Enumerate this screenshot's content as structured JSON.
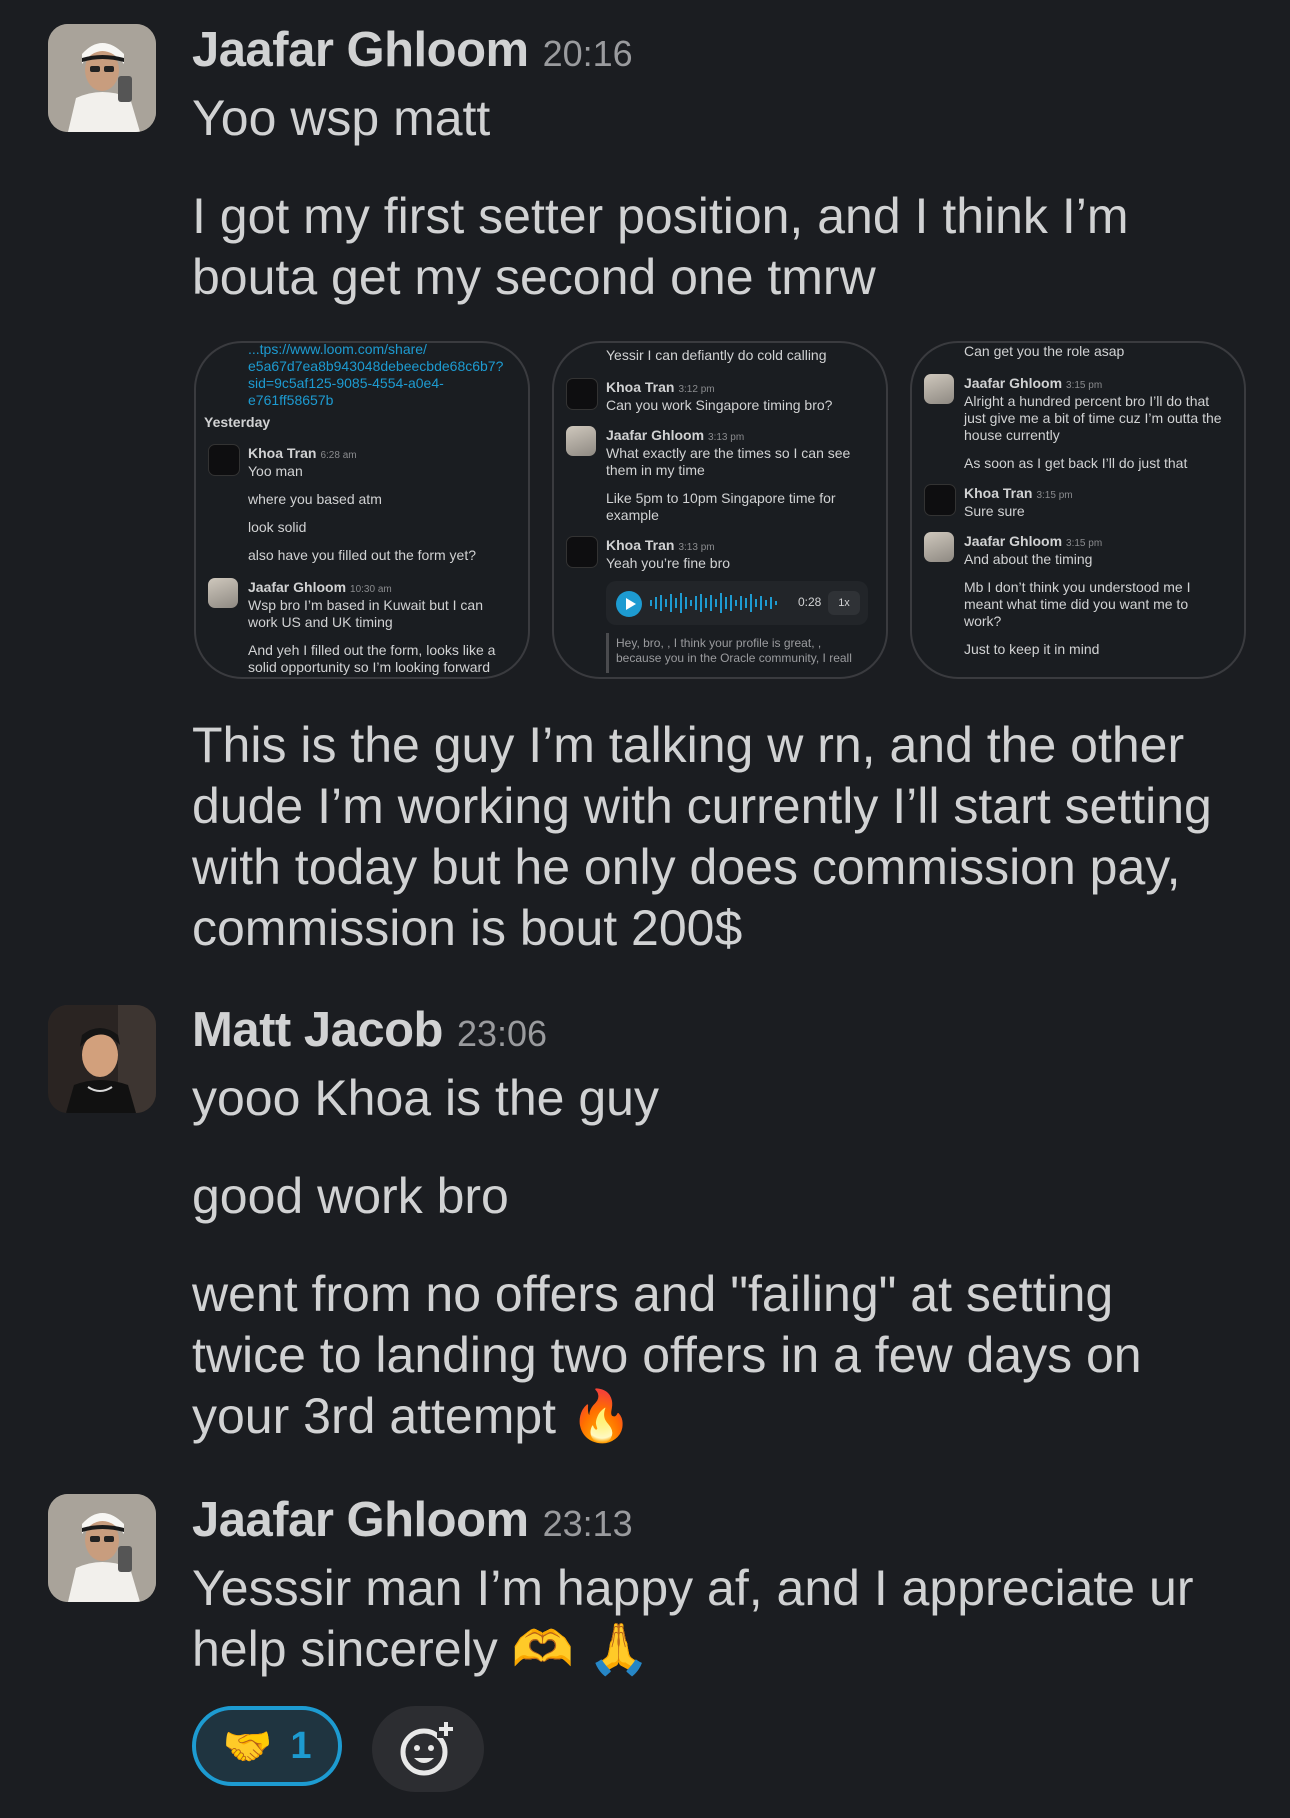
{
  "messages": [
    {
      "author": "Jaafar Ghloom",
      "time": "20:16",
      "avatar_icon": "avatar-photo",
      "paragraphs": [
        "Yoo wsp matt",
        "I got my first setter position, and I think I’m bouta get my second one tmrw",
        "This is the guy I’m talking w rn, and the other dude I’m working with currently I’ll start setting with today but he only does commission pay, commission is bout 200$"
      ]
    },
    {
      "author": "Matt Jacob",
      "time": "23:06",
      "avatar_icon": "avatar-photo",
      "paragraphs": [
        "yooo Khoa is the guy",
        "good work bro",
        "went from no offers and \"failing\" at setting twice to landing two offers in a few days on your 3rd attempt 🔥"
      ]
    },
    {
      "author": "Jaafar Ghloom",
      "time": "23:13",
      "avatar_icon": "avatar-photo",
      "paragraphs": [
        "Yesssir man I’m happy af, and I appreciate ur help sincerely 🫶 🙏"
      ]
    }
  ],
  "attachments": [
    {
      "link": [
        "...tps://www.loom.com/share/",
        "e5a67d7ea8b943048debeecbde68c6b7?",
        "sid=9c5af125-9085-4554-a0e4-",
        "e761ff58657b"
      ],
      "day_label": "Yesterday",
      "khoa_name": "Khoa Tran",
      "khoa_time": "6:28 am",
      "khoa_lines": [
        "Yoo man",
        "where you based atm",
        "look solid",
        "also have you filled out the form yet?"
      ],
      "jaafar_name": "Jaafar Ghloom",
      "jaafar_time": "10:30 am",
      "jaafar_lines": [
        "Wsp bro I’m based in Kuwait but I can",
        "work US and UK timing",
        "And yeh I filled out the form, looks like a",
        "solid opportunity so I’m looking forward"
      ]
    },
    {
      "top_line": "Yessir I can defiantly do cold calling",
      "khoa_name": "Khoa Tran",
      "khoa_time": "3:12 pm",
      "khoa_lines": [
        "Can you work Singapore timing bro?"
      ],
      "jaafar_name": "Jaafar Ghloom",
      "jaafar_time": "3:13 pm",
      "jaafar_lines": [
        "What exactly are the times so I can see",
        "them in my time",
        "Like 5pm to 10pm Singapore time for",
        "example"
      ],
      "khoa2_name": "Khoa Tran",
      "khoa2_time": "3:13 pm",
      "khoa2_lines": [
        "Yeah you’re fine bro"
      ],
      "audio_duration": "0:28",
      "audio_speed": "1x",
      "quote_lines": [
        "Hey, bro, , I think your profile is great, ,",
        "because you in the Oracle community, I reall"
      ]
    },
    {
      "top_line": "Can get you the role asap",
      "jaafar_name": "Jaafar Ghloom",
      "jaafar_time": "3:15 pm",
      "jaafar_lines": [
        "Alright a hundred percent bro I’ll do that",
        "just give me a bit of time cuz I’m outta the",
        "house currently",
        "As soon as I get back I’ll do just that"
      ],
      "khoa_name": "Khoa Tran",
      "khoa_time": "3:15 pm",
      "khoa_lines": [
        "Sure sure"
      ],
      "jaafar2_name": "Jaafar Ghloom",
      "jaafar2_time": "3:15 pm",
      "jaafar2_lines": [
        "And about the timing",
        "Mb I don’t think you understood me I",
        "meant what time did you want me to",
        "work?",
        "Just to keep it in mind"
      ]
    }
  ],
  "reactions": [
    {
      "emoji": "🤝",
      "count": "1",
      "selected": true
    }
  ],
  "add_reaction_icon": "add-emoji-icon",
  "colors": {
    "background": "#1b1d21",
    "text": "#d1d2d3",
    "accent": "#1d9bd1",
    "muted": "#9a9b9e"
  }
}
